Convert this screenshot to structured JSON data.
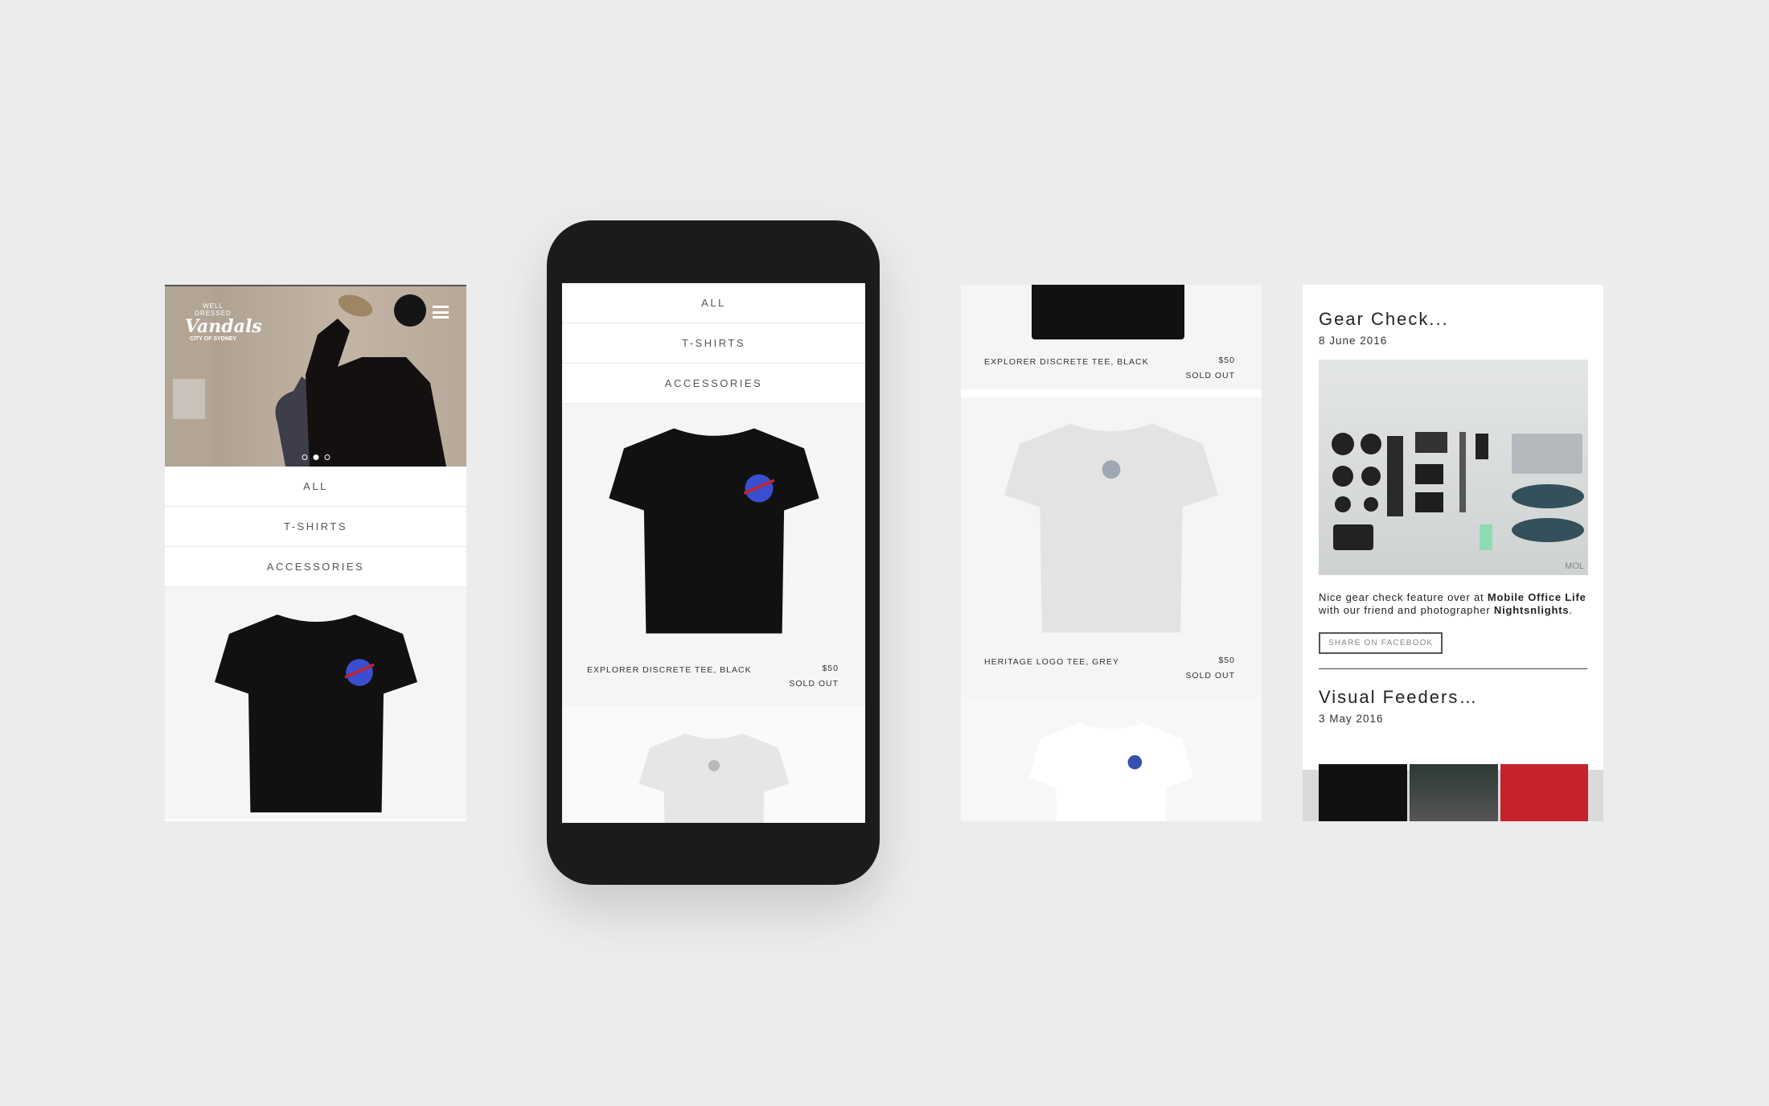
{
  "brand": {
    "line1": "WELL DRESSED",
    "line2": "Vandals",
    "line3": "CITY OF SYDNEY"
  },
  "hero": {
    "slides": 3,
    "active_slide": 2
  },
  "categories": [
    "ALL",
    "T-SHIRTS",
    "ACCESSORIES"
  ],
  "products": [
    {
      "name": "EXPLORER DISCRETE TEE, BLACK",
      "price": "$50",
      "status": "SOLD OUT"
    },
    {
      "name": "HERITAGE LOGO TEE, GREY",
      "price": "$50",
      "status": "SOLD OUT"
    }
  ],
  "blog": [
    {
      "title": "Gear Check...",
      "date": "8 June 2016",
      "text_parts": [
        "Nice gear check feature over at ",
        "Mobile Office Life",
        " with our friend and photographer ",
        "Nightsnlights",
        "."
      ],
      "button": "SHARE ON FACEBOOK",
      "watermark": "MOL"
    },
    {
      "title": "Visual Feeders…",
      "date": "3 May 2016"
    }
  ],
  "colors": {
    "background": "#ececec",
    "phone": "#1b1b1b",
    "accent_red": "#c4232b"
  }
}
